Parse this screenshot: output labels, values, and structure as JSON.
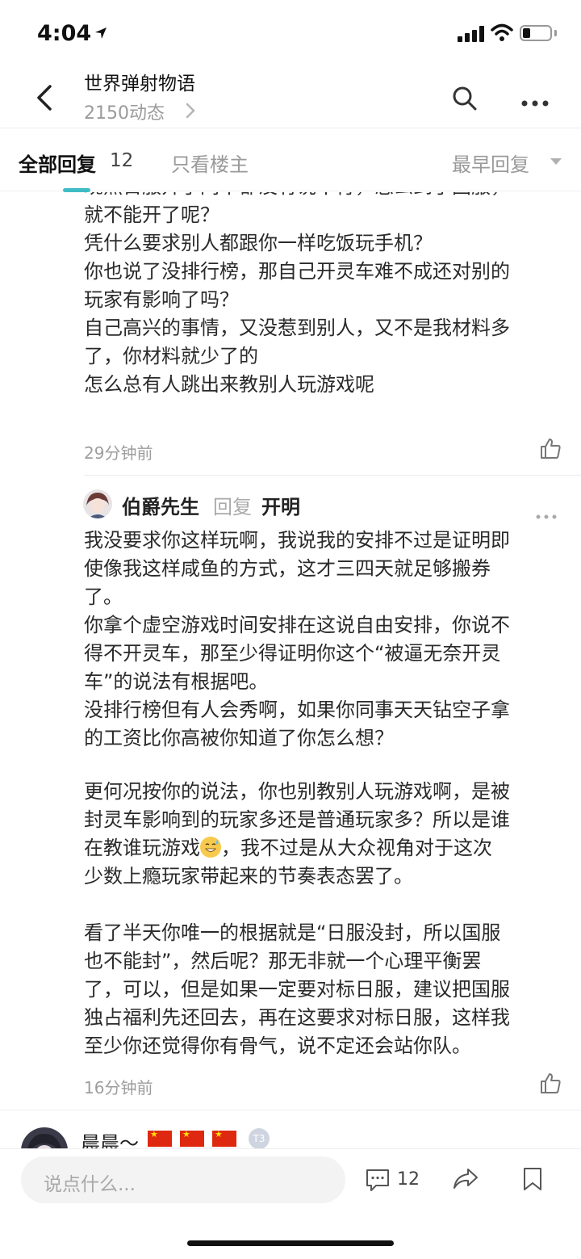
{
  "status": {
    "time": "4:04"
  },
  "header": {
    "title": "世界弹射物语",
    "subtitle": "2150动态"
  },
  "tabs": {
    "all_label": "全部回复",
    "all_count": "12",
    "host_label": "只看楼主",
    "sort_label": "最早回复"
  },
  "comment1": {
    "lines": [
      "现然日服开了同不都没有说不行，怎么到了国服，",
      "就不能开了呢？",
      "凭什么要求别人都跟你一样吃饭玩手机？",
      "你也说了没排行榜，那自己开灵车难不成还对别的",
      "玩家有影响了吗？",
      "自己高兴的事情，又没惹到别人，又不是我材料多",
      "了，你材料就少了的",
      "怎么总有人跳出来教别人玩游戏呢"
    ],
    "time": "29分钟前"
  },
  "comment2": {
    "user": "伯爵先生",
    "reply_word": "回复",
    "reply_to": "开明",
    "lines_a": [
      "我没要求你这样玩啊，我说我的安排不过是证明即",
      "使像我这样咸鱼的方式，这才三四天就足够搬券",
      "了。",
      "你拿个虚空游戏时间安排在这说自由安排，你说不",
      "得不开灵车，那至少得证明你这个“被逼无奈开灵",
      "车”的说法有根据吧。",
      "没排行榜但有人会秀啊，如果你同事天天钻空子拿",
      "的工资比你高被你知道了你怎么想？"
    ],
    "lines_b": [
      "更何况按你的说法，你也别教别人玩游戏啊，是被",
      "封灵车影响到的玩家多还是普通玩家多？所以是谁"
    ],
    "line_emoji_before": "在教谁玩游戏",
    "line_emoji_after": "，我不过是从大众视角对于这次",
    "lines_c": [
      "少数上瘾玩家带起来的节奏表态罢了。"
    ],
    "lines_d": [
      "看了半天你唯一的根据就是“日服没封，所以国服",
      "也不能封”，然后呢？那无非就一个心理平衡罢",
      "了，可以，但是如果一定要对标日服，建议把国服",
      "独占福利先还回去，再在这要求对标日服，这样我",
      "至少你还觉得你有骨气，说不定还会站你队。"
    ],
    "time": "16分钟前"
  },
  "comment3": {
    "user": "晨晨～",
    "badge": "T3"
  },
  "bottom": {
    "placeholder": "说点什么...",
    "comment_count": "12"
  }
}
